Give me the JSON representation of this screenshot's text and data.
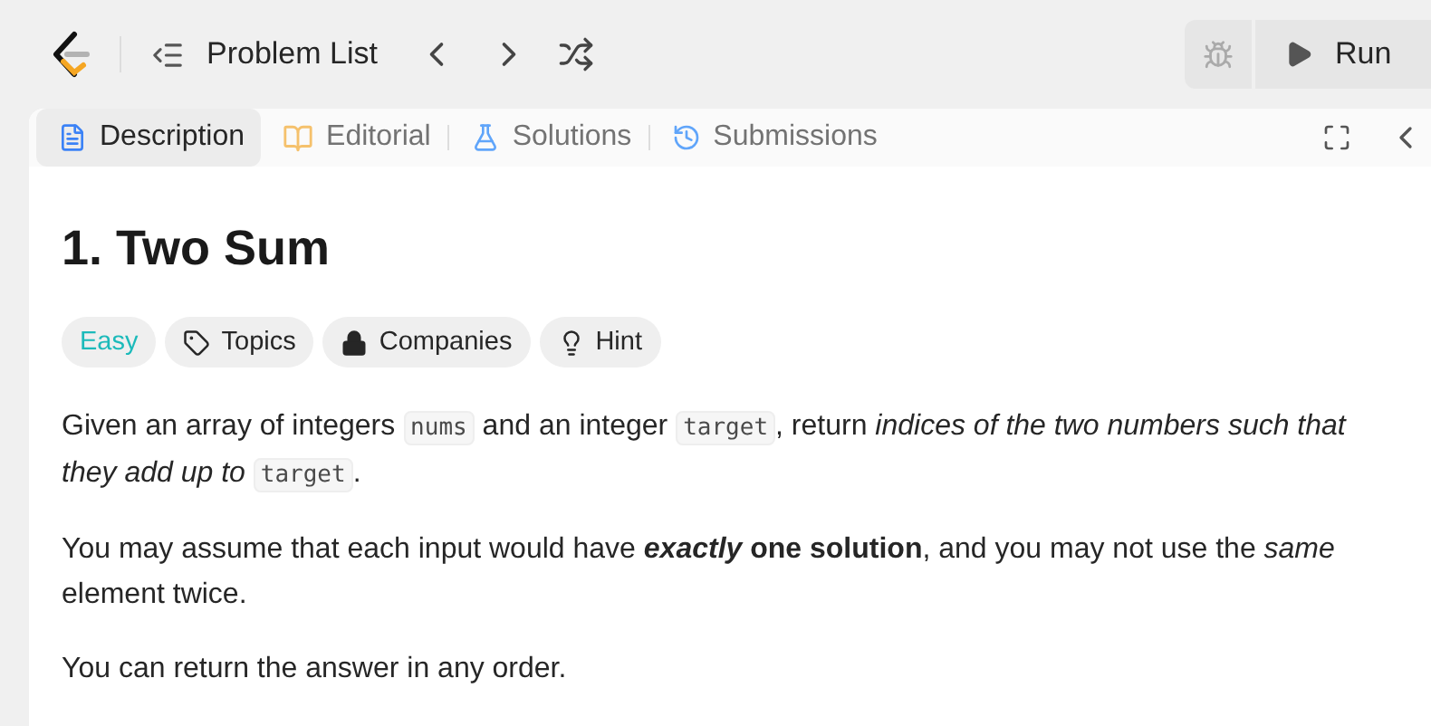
{
  "toolbar": {
    "problem_list": "Problem List",
    "run": "Run"
  },
  "tabs": [
    {
      "label": "Description",
      "kind": "description",
      "selected": true
    },
    {
      "label": "Editorial",
      "kind": "editorial",
      "selected": false
    },
    {
      "label": "Solutions",
      "kind": "solutions",
      "selected": false
    },
    {
      "label": "Submissions",
      "kind": "submissions",
      "selected": false
    }
  ],
  "problem": {
    "title": "1. Two Sum",
    "tags": [
      {
        "label": "Easy",
        "kind": "difficulty"
      },
      {
        "label": "Topics",
        "kind": "topics"
      },
      {
        "label": "Companies",
        "kind": "companies"
      },
      {
        "label": "Hint",
        "kind": "hint"
      }
    ],
    "paragraphs": [
      [
        {
          "kind": "text",
          "text": "Given an array of integers "
        },
        {
          "kind": "code",
          "text": "nums"
        },
        {
          "kind": "text",
          "text": " and an integer "
        },
        {
          "kind": "code",
          "text": "target"
        },
        {
          "kind": "text",
          "text": ", return *indices of the two numbers such that they add up to* "
        },
        {
          "kind": "code",
          "text": "target"
        },
        {
          "kind": "text",
          "text": "."
        }
      ],
      [
        {
          "kind": "text",
          "text": "You may assume that each input would have "
        },
        {
          "kind": "bolditalic",
          "text": "exactly"
        },
        {
          "kind": "text",
          "text": " **one solution**, and you may not use the *same* element twice."
        }
      ],
      [
        {
          "kind": "text",
          "text": "You can return the answer in any order."
        }
      ]
    ]
  }
}
